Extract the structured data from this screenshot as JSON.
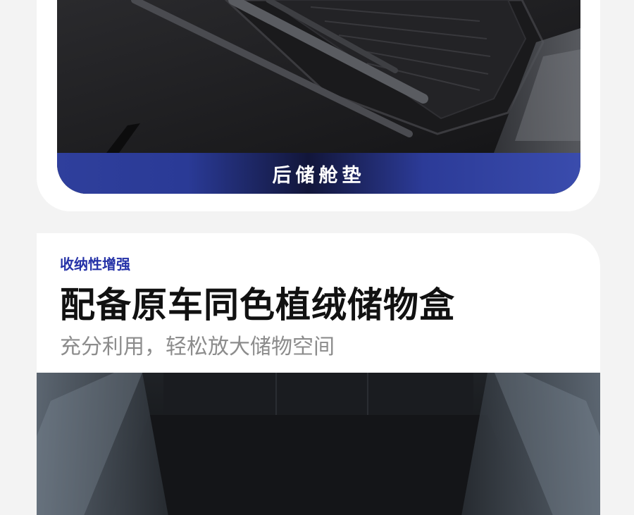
{
  "section_top": {
    "banner_label": "后储舱垫"
  },
  "section_storage": {
    "eyebrow": "收纳性增强",
    "headline": "配备原车同色植绒储物盒",
    "subline": "充分利用，轻松放大储物空间"
  },
  "colors": {
    "accent_blue": "#2633a8",
    "banner_blue": "#2f3f9c",
    "headline": "#111111",
    "subline": "#8c8c8c",
    "page_bg": "#f3f3f3"
  }
}
